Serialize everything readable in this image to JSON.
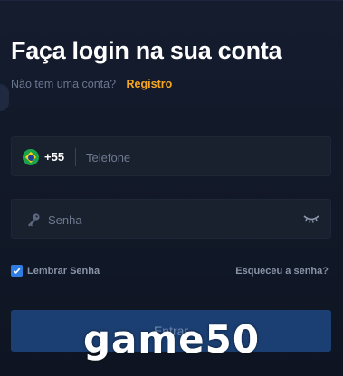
{
  "login": {
    "title": "Faça login na sua conta",
    "no_account_text": "Não tem uma conta?",
    "register_link": "Registro"
  },
  "phone_field": {
    "country_flag_icon": "brazil-flag-icon",
    "country_code": "+55",
    "placeholder": "Telefone",
    "value": ""
  },
  "password_field": {
    "icon": "key-icon",
    "placeholder": "Senha",
    "value": "",
    "toggle_icon": "eye-closed-icon"
  },
  "remember": {
    "label": "Lembrar Senha",
    "checked": true
  },
  "forgot_password_link": "Esqueceu a senha?",
  "submit_button_label": "Entrar",
  "watermark_text": "game50",
  "colors": {
    "background": "#111827",
    "accent": "#f5a623",
    "button": "#1b3f72",
    "checkbox": "#2f7de1"
  }
}
